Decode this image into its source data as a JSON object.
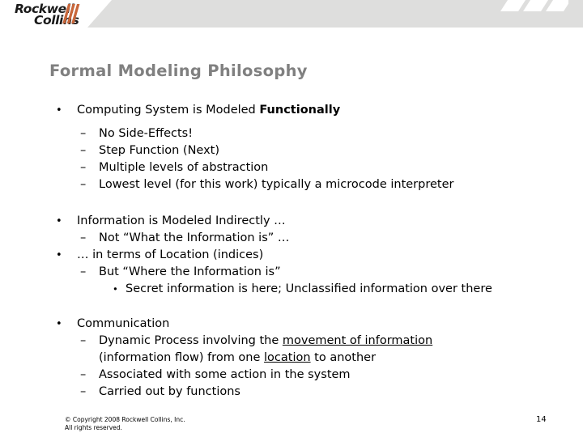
{
  "brand": {
    "logo_line1": "Rockwell",
    "logo_line2": "Collins",
    "accent_color": "#c8663a",
    "band_color": "#dededd"
  },
  "slide": {
    "title": "Formal Modeling Philosophy",
    "title_color": "#808080",
    "page_number": "14"
  },
  "bullets": {
    "b1": "Computing System is Modeled ",
    "b1_bold": "Functionally",
    "b1_sub1": "No Side-Effects!",
    "b1_sub2": "Step Function (Next)",
    "b1_sub3": "Multiple levels of abstraction",
    "b1_sub4": "Lowest level (for this work) typically a microcode interpreter",
    "b2": "Information is Modeled Indirectly …",
    "b2_sub1": "Not “What the Information is” …",
    "b3": "… in terms of Location (indices)",
    "b3_sub1": "But “Where the Information is”",
    "b3_sub1_sub1": "Secret information is here; Unclassified information over there",
    "b4": "Communication",
    "b4_sub1_a": "Dynamic Process involving the ",
    "b4_sub1_u": "movement of information",
    "b4_sub1_cont_a": "(information flow) from one ",
    "b4_sub1_cont_u": "location",
    "b4_sub1_cont_b": " to another",
    "b4_sub2": "Associated with some action in the system",
    "b4_sub3": "Carried out by functions"
  },
  "marks": {
    "bullet_round": "•",
    "bullet_dash": "–",
    "bullet_small": "•"
  },
  "footer": {
    "copyright_line1": "© Copyright 2008 Rockwell Collins, Inc.",
    "copyright_line2": "All rights reserved."
  }
}
